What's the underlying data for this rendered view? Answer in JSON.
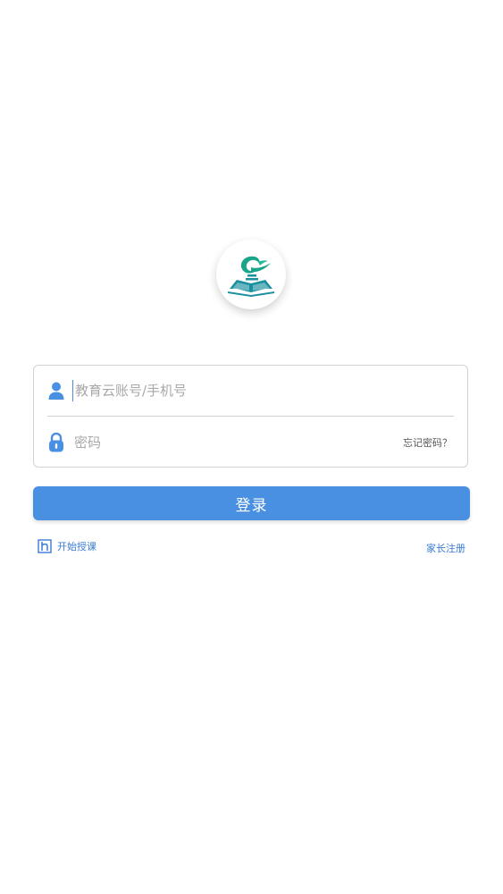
{
  "logo": {
    "icon": "book-dragon-logo-icon"
  },
  "form": {
    "account": {
      "icon": "user-icon",
      "placeholder": "教育云账号/手机号",
      "value": ""
    },
    "password": {
      "icon": "lock-icon",
      "placeholder": "密码",
      "value": "",
      "forgot_label": "忘记密码？"
    }
  },
  "login_label": "登录",
  "links": {
    "start_class_label": "开始授课",
    "start_class_icon": "classroom-icon",
    "parent_register_label": "家长注册"
  },
  "colors": {
    "accent": "#4a90e2",
    "link": "#3a7bd5",
    "logo_green": "#1aa58a",
    "logo_teal": "#1a8fa0"
  }
}
